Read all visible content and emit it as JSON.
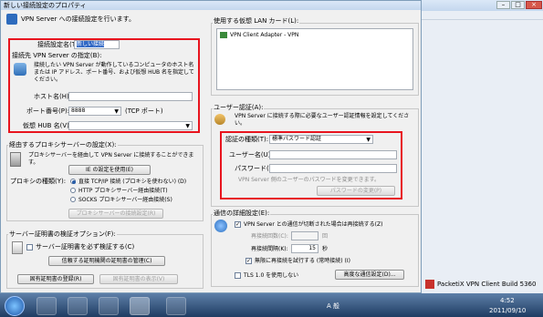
{
  "dialog": {
    "title": "新しい接続設定のプロパティ",
    "intro": "VPN Server への接続設定を行います。",
    "conn_name_label": "接続設定名(T):",
    "conn_name_value": "新しい接続",
    "dest_group_label": "接続先 VPN Server の指定(B):",
    "dest_desc": "接続したい VPN Server が動作しているコンピュータのホスト名または IP アドレス、ポート番号、および仮想 HUB 名を指定してください。",
    "host_label": "ホスト名(H):",
    "host_value": "",
    "port_label": "ポート番号(P):",
    "port_value": "8888",
    "port_suffix": "(TCP ポート)",
    "hub_label": "仮想 HUB 名(V):",
    "hub_value": "",
    "proxy_group_label": "経由するプロキシサーバーの設定(X):",
    "proxy_desc": "プロキシサーバーを経由して VPN Server に接続することができます。",
    "ie_button": "IE の設定を使用(E)",
    "proxy_type_label": "プロキシの種類(Y):",
    "proxy_options": [
      "直接 TCP/IP 接続 (プロキシを使わない) (D)",
      "HTTP プロキシサーバー経由接続(T)",
      "SOCKS プロキシサーバー経由接続(S)"
    ],
    "proxy_settings_button": "プロキシサーバーの接続設定(R)",
    "cert_group_label": "サーバー証明書の検証オプション(F):",
    "cert_check_label": "サーバー証明書を必ず検証する(C)",
    "trusted_ca_button": "信頼する証明機関の証明書の管理(C)",
    "specific_cert_button": "固有証明書の登録(R)",
    "show_cert_button": "固有証明書の表示(V)",
    "adapter_group_label": "使用する仮想 LAN カード(L):",
    "adapter_item": "VPN Client Adapter - VPN",
    "auth_group_label": "ユーザー認証(A):",
    "auth_desc": "VPN Server に接続する際に必要なユーザー認証情報を設定してください。",
    "auth_type_label": "認証の種類(T):",
    "auth_type_value": "標準パスワード認証",
    "user_label": "ユーザー名(U):",
    "user_value": "",
    "pass_label": "パスワード(Y):",
    "pass_value": "",
    "pass_note": "VPN Server 側のユーザーのパスワードを変更できます。",
    "change_pass_button": "パスワードの変更(P)",
    "adv_group_label": "通信の詳細設定(E):",
    "reconnect_label": "VPN Server との通信が切断された場合は再接続する(Z)",
    "retry_count_label": "再接続回数(C):",
    "retry_count_suffix": "回",
    "retry_interval_label": "再接続間隔(K):",
    "retry_interval_value": "15",
    "retry_interval_suffix": "秒",
    "infinite_label": "無限に再接続を試行する (常時接続) (I)",
    "tls_label": "TLS 1.0 を使用しない",
    "advanced_button": "高度な通信設定(D)..."
  },
  "taskbar": {
    "time": "4:52",
    "date": "2011/09/10",
    "app_label": "PacketiX VPN Client Build 5360",
    "ime": "A 般"
  }
}
